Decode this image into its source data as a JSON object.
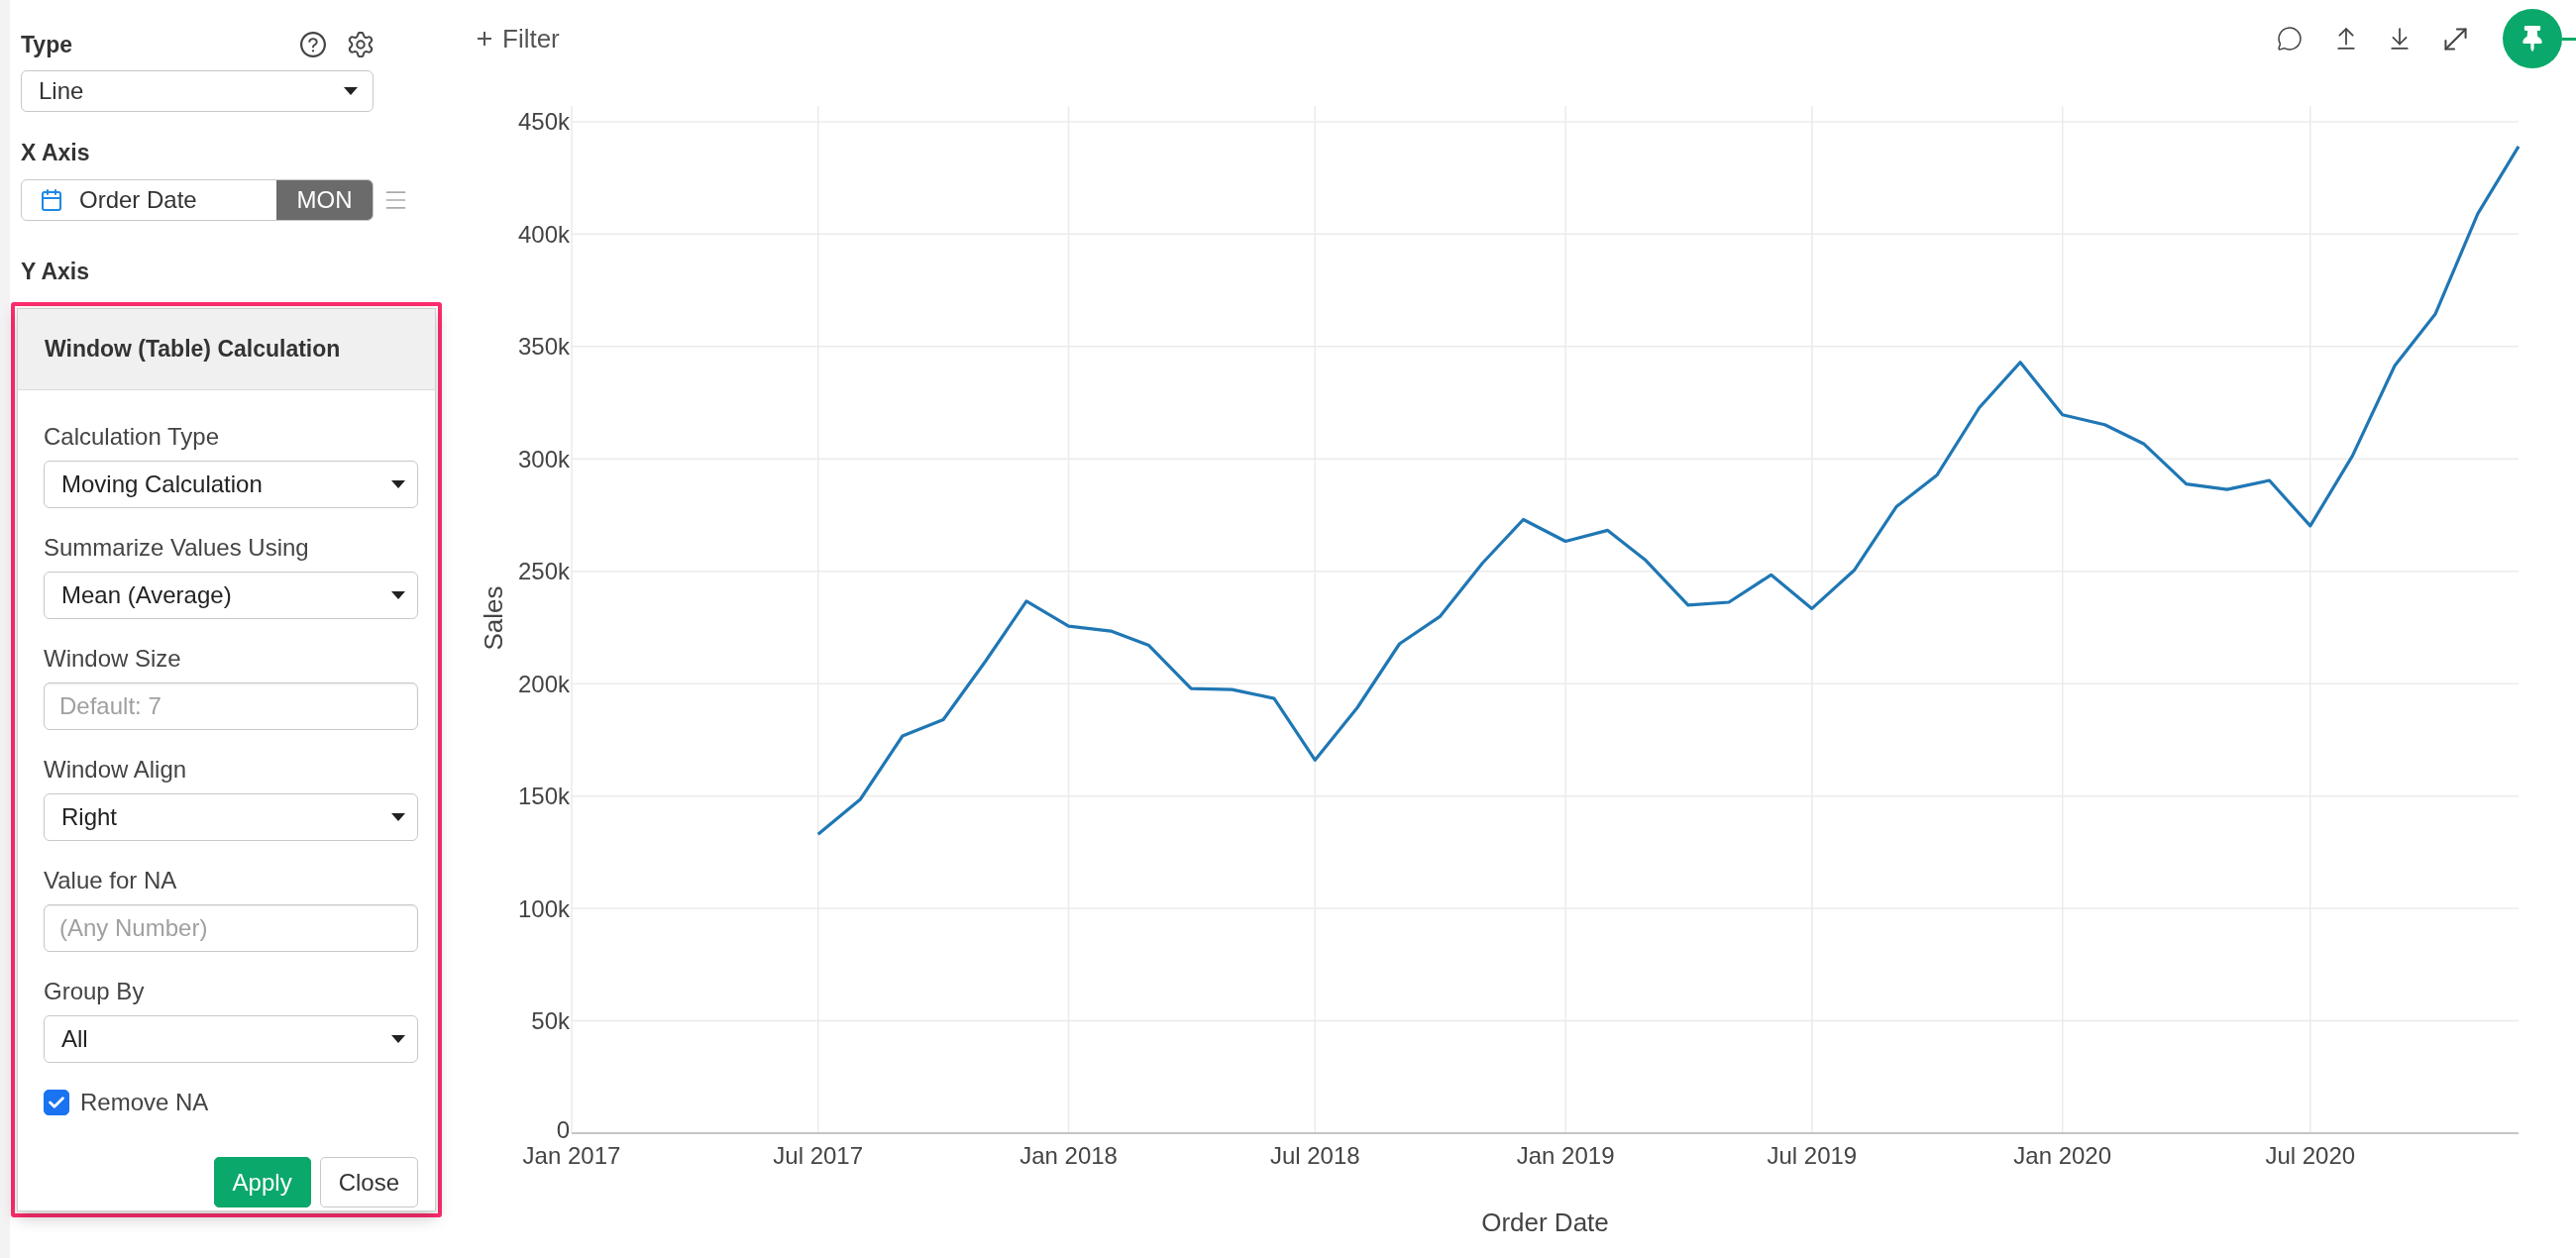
{
  "sidebar": {
    "type_section": {
      "label": "Type",
      "value": "Line"
    },
    "x_axis": {
      "label": "X Axis",
      "column": "Order Date",
      "unit": "MON"
    },
    "y_axis": {
      "label": "Y Axis"
    }
  },
  "calculation_popup": {
    "title": "Window (Table) Calculation",
    "fields": [
      {
        "kind": "select",
        "label": "Calculation Type",
        "value": "Moving Calculation"
      },
      {
        "kind": "select",
        "label": "Summarize Values Using",
        "value": "Mean (Average)"
      },
      {
        "kind": "input",
        "label": "Window Size",
        "placeholder": "Default: 7"
      },
      {
        "kind": "select",
        "label": "Window Align",
        "value": "Right"
      },
      {
        "kind": "input",
        "label": "Value for NA",
        "placeholder": "(Any Number)"
      },
      {
        "kind": "select",
        "label": "Group By",
        "value": "All"
      }
    ],
    "remove_na": {
      "label": "Remove NA",
      "checked": true
    },
    "buttons": [
      {
        "kind": "primary",
        "label": "Apply"
      },
      {
        "kind": "secondary",
        "label": "Close"
      }
    ]
  },
  "toolbar": {
    "filter_label": "Filter"
  },
  "chart": {
    "chart_data": {
      "type": "line",
      "xlabel": "Order Date",
      "ylabel": "Sales",
      "grid": true,
      "x": [
        "2017-07",
        "2017-08",
        "2017-09",
        "2017-10",
        "2017-11",
        "2017-12",
        "2018-01",
        "2018-02",
        "2018-03",
        "2018-04",
        "2018-05",
        "2018-06",
        "2018-07",
        "2018-08",
        "2018-09",
        "2018-10",
        "2018-11",
        "2018-12",
        "2019-01",
        "2019-02",
        "2019-03",
        "2019-04",
        "2019-05",
        "2019-06",
        "2019-07",
        "2019-08",
        "2019-09",
        "2019-10",
        "2019-11",
        "2019-12",
        "2020-01",
        "2020-02",
        "2020-03",
        "2020-04",
        "2020-05",
        "2020-06",
        "2020-07",
        "2020-08",
        "2020-09",
        "2020-10",
        "2020-11",
        "2020-12"
      ],
      "series": [
        {
          "color": "#1f77b4",
          "values": [
            133000,
            148500,
            176700,
            184000,
            210000,
            236700,
            225600,
            223400,
            217000,
            197800,
            197400,
            193400,
            166000,
            189300,
            217700,
            230000,
            253600,
            273000,
            263300,
            268200,
            254800,
            235000,
            236200,
            248400,
            233400,
            250400,
            278700,
            292900,
            322800,
            343000,
            319600,
            315200,
            306600,
            288800,
            286400,
            290400,
            270200,
            301400,
            341400,
            364600,
            409000,
            439000
          ]
        }
      ],
      "xlim": [
        "2017-01",
        "2020-12"
      ],
      "ylim": [
        0,
        457000
      ],
      "xticks": [
        {
          "value": "2017-01",
          "label": "Jan 2017"
        },
        {
          "value": "2017-07",
          "label": "Jul 2017"
        },
        {
          "value": "2018-01",
          "label": "Jan 2018"
        },
        {
          "value": "2018-07",
          "label": "Jul 2018"
        },
        {
          "value": "2019-01",
          "label": "Jan 2019"
        },
        {
          "value": "2019-07",
          "label": "Jul 2019"
        },
        {
          "value": "2020-01",
          "label": "Jan 2020"
        },
        {
          "value": "2020-07",
          "label": "Jul 2020"
        }
      ],
      "yticks": [
        {
          "value": 0,
          "label": "0"
        },
        {
          "value": 50000,
          "label": "50k"
        },
        {
          "value": 100000,
          "label": "100k"
        },
        {
          "value": 150000,
          "label": "150k"
        },
        {
          "value": 200000,
          "label": "200k"
        },
        {
          "value": 250000,
          "label": "250k"
        },
        {
          "value": 300000,
          "label": "300k"
        },
        {
          "value": 350000,
          "label": "350k"
        },
        {
          "value": 400000,
          "label": "400k"
        },
        {
          "value": 450000,
          "label": "450k"
        }
      ]
    }
  }
}
